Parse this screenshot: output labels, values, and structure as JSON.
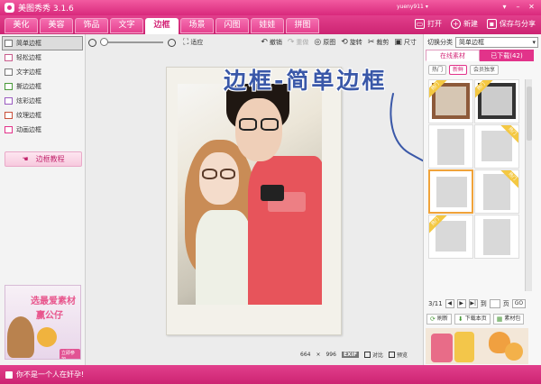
{
  "window": {
    "title": "美图秀秀 3.1.6",
    "user": "yueny911",
    "user_caret": "▾",
    "minimize": "▾",
    "restore": "–",
    "close": "✕",
    "colors": {
      "accent": "#e2338a",
      "bar": "#d9297c"
    }
  },
  "nav": {
    "tabs": [
      "美化",
      "美容",
      "饰品",
      "文字",
      "边框",
      "场景",
      "闪图",
      "娃娃",
      "拼图"
    ],
    "active_tab": "边框",
    "open": "打开",
    "new": "新建",
    "save_share": "保存与分享"
  },
  "sidebar": {
    "items": [
      "简单边框",
      "轻松边框",
      "文字边框",
      "撕边边框",
      "炫彩边框",
      "纹理边框",
      "动画边框"
    ],
    "tutorial": "边框教程",
    "ad": {
      "line1": "选最爱素材",
      "line2": "赢公仔",
      "button": "立即参加"
    }
  },
  "toolbar": {
    "fit": "适应",
    "undo": "撤销",
    "redo": "重做",
    "original": "原图",
    "rotate": "旋转",
    "crop": "裁剪",
    "size": "尺寸",
    "zoom_level": 0
  },
  "overlay": {
    "text": "边框-简单边框"
  },
  "canvas": {
    "width": "664",
    "times": "×",
    "height": "996",
    "exif": "EXIF",
    "compare": "对比",
    "preview": "预览"
  },
  "rightpanel": {
    "category_label": "切换分类",
    "category_value": "简单边框",
    "tab_online": "在线素材",
    "tab_downloaded": "已下载(42)",
    "sub_hot": "热门",
    "sub_new": "新鲜",
    "sub_vip": "会员独享",
    "badge": "热门",
    "page_current": "3/11",
    "page_to": "到",
    "page_unit": "页",
    "page_go": "GO",
    "refresh": "刷新",
    "download_page": "下载本页",
    "material_pack": "素材包"
  },
  "status": {
    "text": "你不是一个人在奸孕!"
  }
}
